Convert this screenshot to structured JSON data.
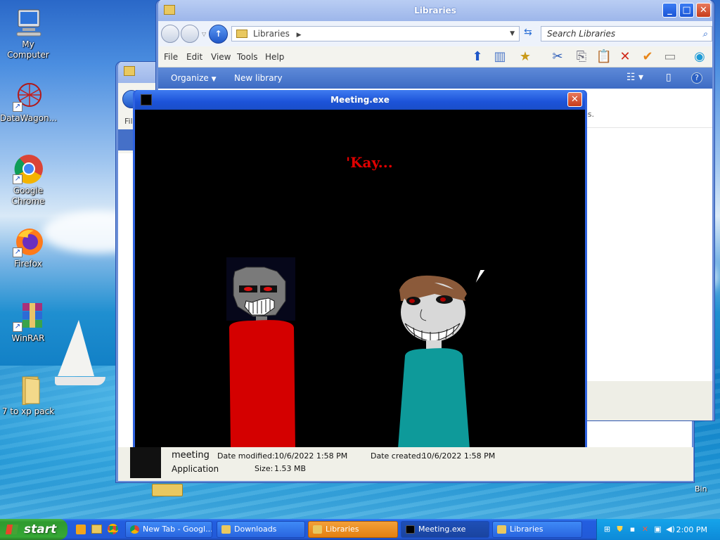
{
  "desktop": {
    "icons": [
      {
        "label": "My Computer"
      },
      {
        "label": "DataWagon..."
      },
      {
        "label": "Google Chrome"
      },
      {
        "label": "Firefox"
      },
      {
        "label": "WinRAR"
      },
      {
        "label": "7 to xp pack"
      }
    ],
    "recycle_bin_label": "Bin"
  },
  "libraries_window": {
    "title": "Libraries",
    "address": "Libraries",
    "search_placeholder": "Search Libraries",
    "menu": [
      "File",
      "Edit",
      "View",
      "Tools",
      "Help"
    ],
    "commands": {
      "organize": "Organize",
      "new_library": "New library"
    },
    "pane_fragment": "es."
  },
  "back_window": {
    "menu_fragment": "File"
  },
  "meeting_window": {
    "title": "Meeting.exe",
    "caption": "'Kay..."
  },
  "details": {
    "name": "meeting",
    "type": "Application",
    "date_modified_label": "Date modified:",
    "date_modified": "10/6/2022 1:58 PM",
    "size_label": "Size:",
    "size": "1.53 MB",
    "date_created_label": "Date created:",
    "date_created": "10/6/2022 1:58 PM"
  },
  "taskbar": {
    "start_label": "start",
    "buttons": [
      {
        "label": "New Tab - Googl...",
        "icon": "chrome-icon"
      },
      {
        "label": "Downloads",
        "icon": "folder-icon"
      },
      {
        "label": "Libraries",
        "icon": "folder-icon",
        "state": "active"
      },
      {
        "label": "Meeting.exe",
        "icon": "app-icon"
      },
      {
        "label": "Libraries",
        "icon": "folder-icon"
      }
    ],
    "clock": "2:00 PM"
  },
  "colors": {
    "caption_red": "#e00000",
    "taskbar_blue": "#235ee0",
    "start_green": "#35a835",
    "shirt_red": "#d40000",
    "shirt_teal": "#0e9a9a"
  }
}
